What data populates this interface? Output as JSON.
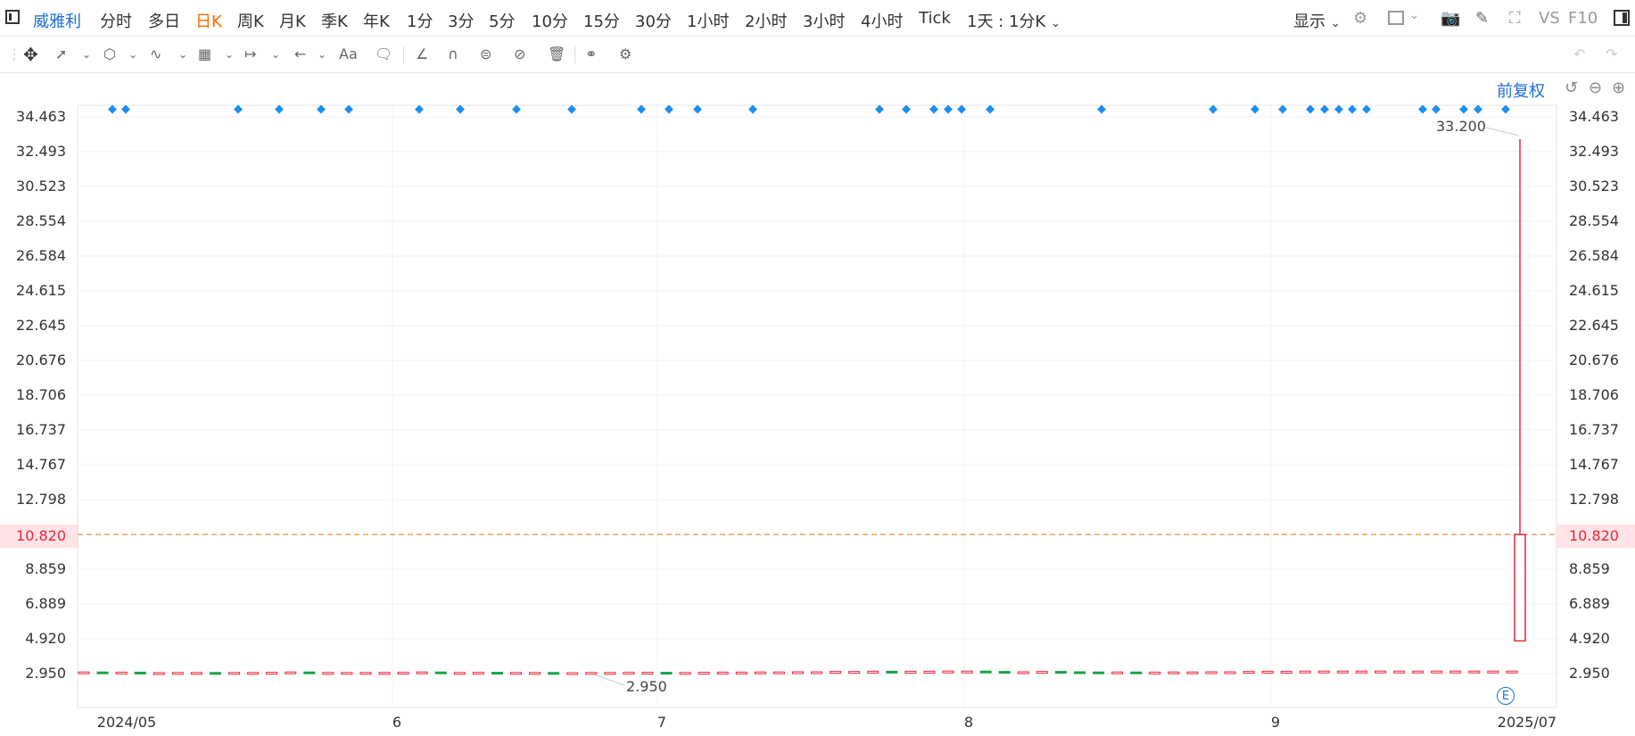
{
  "toolbar": {
    "stock_name": "威雅利",
    "periods": [
      "分时",
      "多日",
      "日K",
      "周K",
      "月K",
      "季K",
      "年K",
      "1分",
      "3分",
      "5分",
      "10分",
      "15分",
      "30分",
      "1小时",
      "2小时",
      "3小时",
      "4小时",
      "Tick"
    ],
    "active_period": "日K",
    "interval_select": "1天 : 1分K",
    "display_label": "显示",
    "vs_label": "VS",
    "f10_label": "F10"
  },
  "chart": {
    "adjust_label": "前复权",
    "current_price": "10.820",
    "high_label": "33.200",
    "low_label": "2.950"
  },
  "chart_data": {
    "type": "candlestick",
    "y_ticks": [
      "34.463",
      "32.493",
      "30.523",
      "28.554",
      "26.584",
      "24.615",
      "22.645",
      "20.676",
      "18.706",
      "16.737",
      "14.767",
      "12.798",
      "10.820",
      "8.859",
      "6.889",
      "4.920",
      "2.950"
    ],
    "ylim": [
      2.95,
      34.463
    ],
    "x_ticks": [
      "2024/05",
      "6",
      "7",
      "8",
      "9",
      "2025/07"
    ],
    "max_high": 33.2,
    "min_low": 2.95,
    "last_candle": {
      "open": 4.8,
      "close": 10.82,
      "high": 33.2,
      "low": 4.8
    },
    "price_line": 10.82,
    "candles": [
      {
        "o": 2.95,
        "c": 2.99
      },
      {
        "o": 2.99,
        "c": 2.95
      },
      {
        "o": 2.95,
        "c": 2.98
      },
      {
        "o": 2.98,
        "c": 2.95
      },
      {
        "o": 2.95,
        "c": 2.95
      },
      {
        "o": 2.95,
        "c": 2.96
      },
      {
        "o": 2.96,
        "c": 2.96
      },
      {
        "o": 2.96,
        "c": 2.95
      },
      {
        "o": 2.95,
        "c": 2.96
      },
      {
        "o": 2.96,
        "c": 2.96
      },
      {
        "o": 2.96,
        "c": 2.97
      },
      {
        "o": 2.95,
        "c": 2.99
      },
      {
        "o": 2.99,
        "c": 2.95
      },
      {
        "o": 2.95,
        "c": 2.96
      },
      {
        "o": 2.96,
        "c": 2.96
      },
      {
        "o": 2.96,
        "c": 2.96
      },
      {
        "o": 2.96,
        "c": 2.96
      },
      {
        "o": 2.96,
        "c": 2.97
      },
      {
        "o": 2.95,
        "c": 2.99
      },
      {
        "o": 2.99,
        "c": 2.95
      },
      {
        "o": 2.95,
        "c": 2.96
      },
      {
        "o": 2.96,
        "c": 2.97
      },
      {
        "o": 2.97,
        "c": 2.96
      },
      {
        "o": 2.96,
        "c": 2.96
      },
      {
        "o": 2.96,
        "c": 2.96
      },
      {
        "o": 2.96,
        "c": 2.95
      },
      {
        "o": 2.95,
        "c": 2.95
      },
      {
        "o": 2.95,
        "c": 2.96
      },
      {
        "o": 2.96,
        "c": 2.96
      },
      {
        "o": 2.96,
        "c": 2.97
      },
      {
        "o": 2.97,
        "c": 2.97
      },
      {
        "o": 2.97,
        "c": 2.96
      },
      {
        "o": 2.96,
        "c": 2.96
      },
      {
        "o": 2.96,
        "c": 2.97
      },
      {
        "o": 2.97,
        "c": 2.98
      },
      {
        "o": 2.98,
        "c": 2.98
      },
      {
        "o": 2.98,
        "c": 2.99
      },
      {
        "o": 2.99,
        "c": 2.99
      },
      {
        "o": 2.99,
        "c": 3.0
      },
      {
        "o": 3.0,
        "c": 3.0
      },
      {
        "o": 3.0,
        "c": 3.02
      },
      {
        "o": 3.02,
        "c": 3.02
      },
      {
        "o": 3.02,
        "c": 3.03
      },
      {
        "o": 3.03,
        "c": 3.02
      },
      {
        "o": 3.02,
        "c": 3.03
      },
      {
        "o": 3.03,
        "c": 3.03
      },
      {
        "o": 3.03,
        "c": 3.04
      },
      {
        "o": 3.04,
        "c": 3.04
      },
      {
        "o": 3.04,
        "c": 3.02
      },
      {
        "o": 3.02,
        "c": 3.0
      },
      {
        "o": 3.0,
        "c": 3.0
      },
      {
        "o": 3.0,
        "c": 3.02
      },
      {
        "o": 3.02,
        "c": 3.0
      },
      {
        "o": 3.0,
        "c": 2.99
      },
      {
        "o": 2.99,
        "c": 2.98
      },
      {
        "o": 2.98,
        "c": 2.99
      },
      {
        "o": 2.99,
        "c": 2.98
      },
      {
        "o": 2.98,
        "c": 2.98
      },
      {
        "o": 2.98,
        "c": 2.99
      },
      {
        "o": 2.99,
        "c": 2.99
      },
      {
        "o": 2.99,
        "c": 3.0
      },
      {
        "o": 3.0,
        "c": 3.0
      },
      {
        "o": 3.0,
        "c": 3.02
      },
      {
        "o": 3.02,
        "c": 3.03
      },
      {
        "o": 3.03,
        "c": 3.03
      },
      {
        "o": 3.03,
        "c": 3.04
      },
      {
        "o": 3.04,
        "c": 3.04
      },
      {
        "o": 3.04,
        "c": 3.04
      },
      {
        "o": 3.04,
        "c": 3.04
      },
      {
        "o": 3.04,
        "c": 3.04
      },
      {
        "o": 3.04,
        "c": 3.04
      },
      {
        "o": 3.04,
        "c": 3.04
      },
      {
        "o": 3.04,
        "c": 3.04
      },
      {
        "o": 3.04,
        "c": 3.04
      },
      {
        "o": 3.04,
        "c": 3.04
      },
      {
        "o": 3.04,
        "c": 3.04
      },
      {
        "o": 3.04,
        "c": 3.04
      }
    ],
    "dividend_markers": 38
  }
}
